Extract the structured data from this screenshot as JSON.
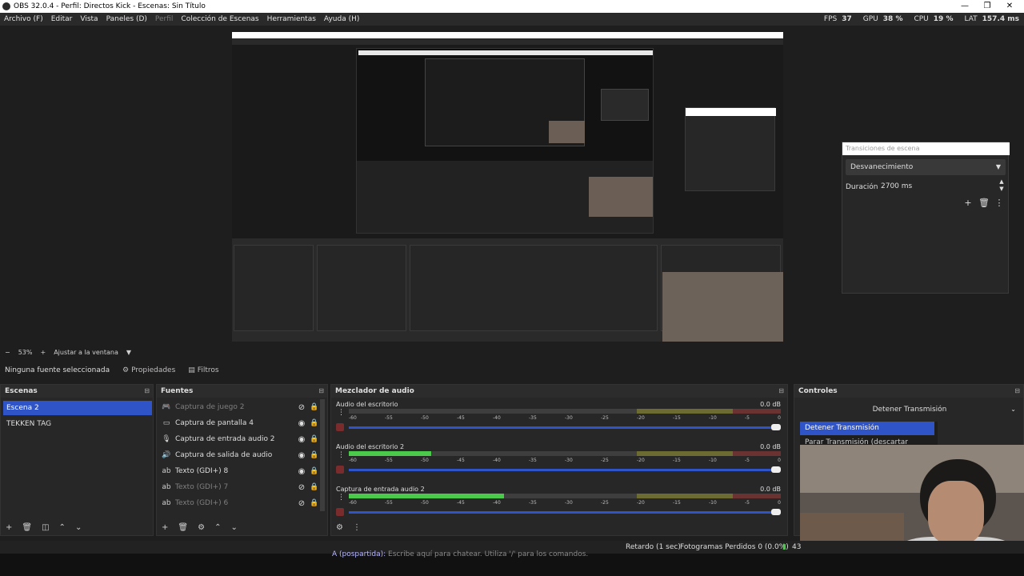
{
  "window": {
    "title": "OBS 32.0.4 - Perfil: Directos Kick - Escenas: Sin Título"
  },
  "menu": [
    "Archivo (F)",
    "Editar",
    "Vista",
    "Paneles (D)",
    "Perfil",
    "Colección de Escenas",
    "Herramientas",
    "Ayuda (H)"
  ],
  "stats": {
    "fps_label": "FPS",
    "fps": "37",
    "gpu_label": "GPU",
    "gpu": "38 %",
    "cpu_label": "CPU",
    "cpu": "19 %",
    "lat_label": "LAT",
    "lat": "157.4 ms"
  },
  "transitions": {
    "title": "Transiciones de escena",
    "selected": "Desvanecimiento",
    "duration_label": "Duración",
    "duration_value": "2700 ms"
  },
  "zoom": {
    "value": "53%",
    "mode": "Ajustar a la ventana"
  },
  "source_toolbar": {
    "no_source": "Ninguna fuente seleccionada",
    "properties": "Propiedades",
    "filters": "Filtros"
  },
  "scenes": {
    "title": "Escenas",
    "items": [
      "Escena 2",
      "TEKKEN TAG"
    ],
    "selected_index": 0
  },
  "sources": {
    "title": "Fuentes",
    "items": [
      {
        "label": "Captura de juego 2",
        "icon": "gamepad-icon",
        "visible": false
      },
      {
        "label": "Captura de pantalla 4",
        "icon": "monitor-icon",
        "visible": true
      },
      {
        "label": "Captura de entrada audio 2",
        "icon": "microphone-icon",
        "visible": true
      },
      {
        "label": "Captura de salida de audio",
        "icon": "speaker-icon",
        "visible": true
      },
      {
        "label": "Texto (GDI+) 8",
        "icon": "text-icon",
        "visible": true
      },
      {
        "label": "Texto (GDI+) 7",
        "icon": "text-icon",
        "visible": false
      },
      {
        "label": "Texto (GDI+) 6",
        "icon": "text-icon",
        "visible": false
      }
    ]
  },
  "mixer": {
    "title": "Mezclador de audio",
    "scale": [
      "-60",
      "-55",
      "-50",
      "-45",
      "-40",
      "-35",
      "-30",
      "-25",
      "-20",
      "-15",
      "-10",
      "-5",
      "0"
    ],
    "channels": [
      {
        "name": "Audio del escritorio",
        "db": "0.0 dB",
        "level": 0.0
      },
      {
        "name": "Audio del escritorio 2",
        "db": "0.0 dB",
        "level": 0.19
      },
      {
        "name": "Captura de entrada audio 2",
        "db": "0.0 dB",
        "level": 0.36
      }
    ]
  },
  "controls": {
    "title": "Controles",
    "selected": "Detener Transmisión",
    "options": [
      "Detener Transmisión",
      "Parar Transmisión (descartar retardo)"
    ]
  },
  "status": {
    "delay": "Retardo (1 sec)",
    "frames_dropped": "Fotogramas Perdidos 0 (0.0%)",
    "kbps_partial": "43"
  },
  "chat": {
    "user": "A (pospartida):",
    "hint": "Escribe aquí para chatear. Utiliza '/' para los comandos."
  },
  "colors": {
    "accent": "#2f54c8",
    "meter_green": "#4bc94b",
    "background": "#1f1e1f"
  }
}
